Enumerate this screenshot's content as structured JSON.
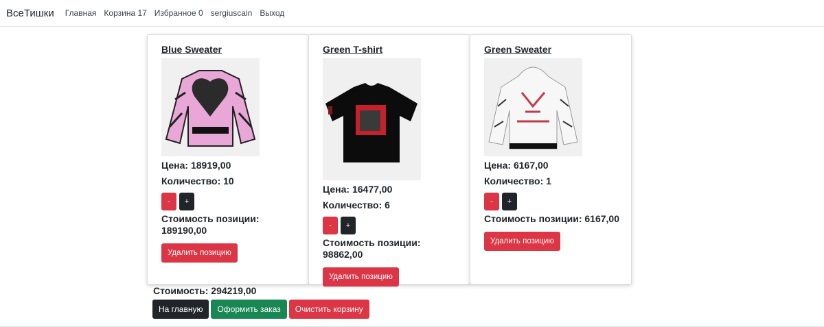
{
  "navbar": {
    "brand": "ВсеТишки",
    "links": [
      "Главная",
      "Корзина 17",
      "Избранное 0",
      "sergiuscain",
      "Выход"
    ]
  },
  "cart": {
    "items": [
      {
        "title": "Blue Sweater",
        "price": "Цена: 18919,00",
        "quantity": "Количество: 10",
        "minus": "-",
        "plus": "+",
        "line_total": "Стоимость позиции: 189190,00",
        "remove": "Удалить позицию"
      },
      {
        "title": "Green T-shirt",
        "price": "Цена: 16477,00",
        "quantity": "Количество: 6",
        "minus": "-",
        "plus": "+",
        "line_total": "Стоимость позиции: 98862,00",
        "remove": "Удалить позицию"
      },
      {
        "title": "Green Sweater",
        "price": "Цена: 6167,00",
        "quantity": "Количество: 1",
        "minus": "-",
        "plus": "+",
        "line_total": "Стоимость позиции: 6167,00",
        "remove": "Удалить позицию"
      }
    ],
    "total": "Стоимость: 294219,00",
    "actions": {
      "home": "На главную",
      "checkout": "Оформить заказ",
      "clear": "Очистить корзину"
    }
  },
  "colors": {
    "danger": "#dc3545",
    "dark": "#212529",
    "success": "#198754"
  }
}
